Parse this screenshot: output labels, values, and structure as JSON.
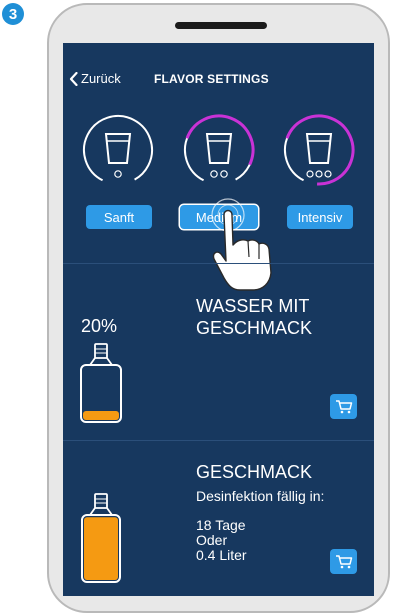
{
  "step": {
    "number": "3"
  },
  "nav": {
    "back_label": "Zurück",
    "title": "FLAVOR SETTINGS"
  },
  "flavor_options": [
    {
      "label": "Sanft",
      "level": 0,
      "selected": false
    },
    {
      "label": "Medium",
      "level": 0.6,
      "selected": true
    },
    {
      "label": "Intensiv",
      "level": 0.85,
      "selected": false
    }
  ],
  "cartridge_flavored_water": {
    "percent": "20%",
    "fill_fraction": 0.2,
    "title_line1": "WASSER MIT",
    "title_line2": "GESCHMACK"
  },
  "cartridge_flavor": {
    "fill_fraction": 0.95,
    "title": "GESCHMACK",
    "disinfection_label": "Desinfektion fällig in:",
    "days": "18 Tage",
    "or_label": "Oder",
    "liters": "0.4 Liter"
  },
  "colors": {
    "screen_bg": "#17385f",
    "accent_blue": "#2e9ae6",
    "gauge_magenta": "#c932d6",
    "cartridge_orange": "#f59a12"
  }
}
